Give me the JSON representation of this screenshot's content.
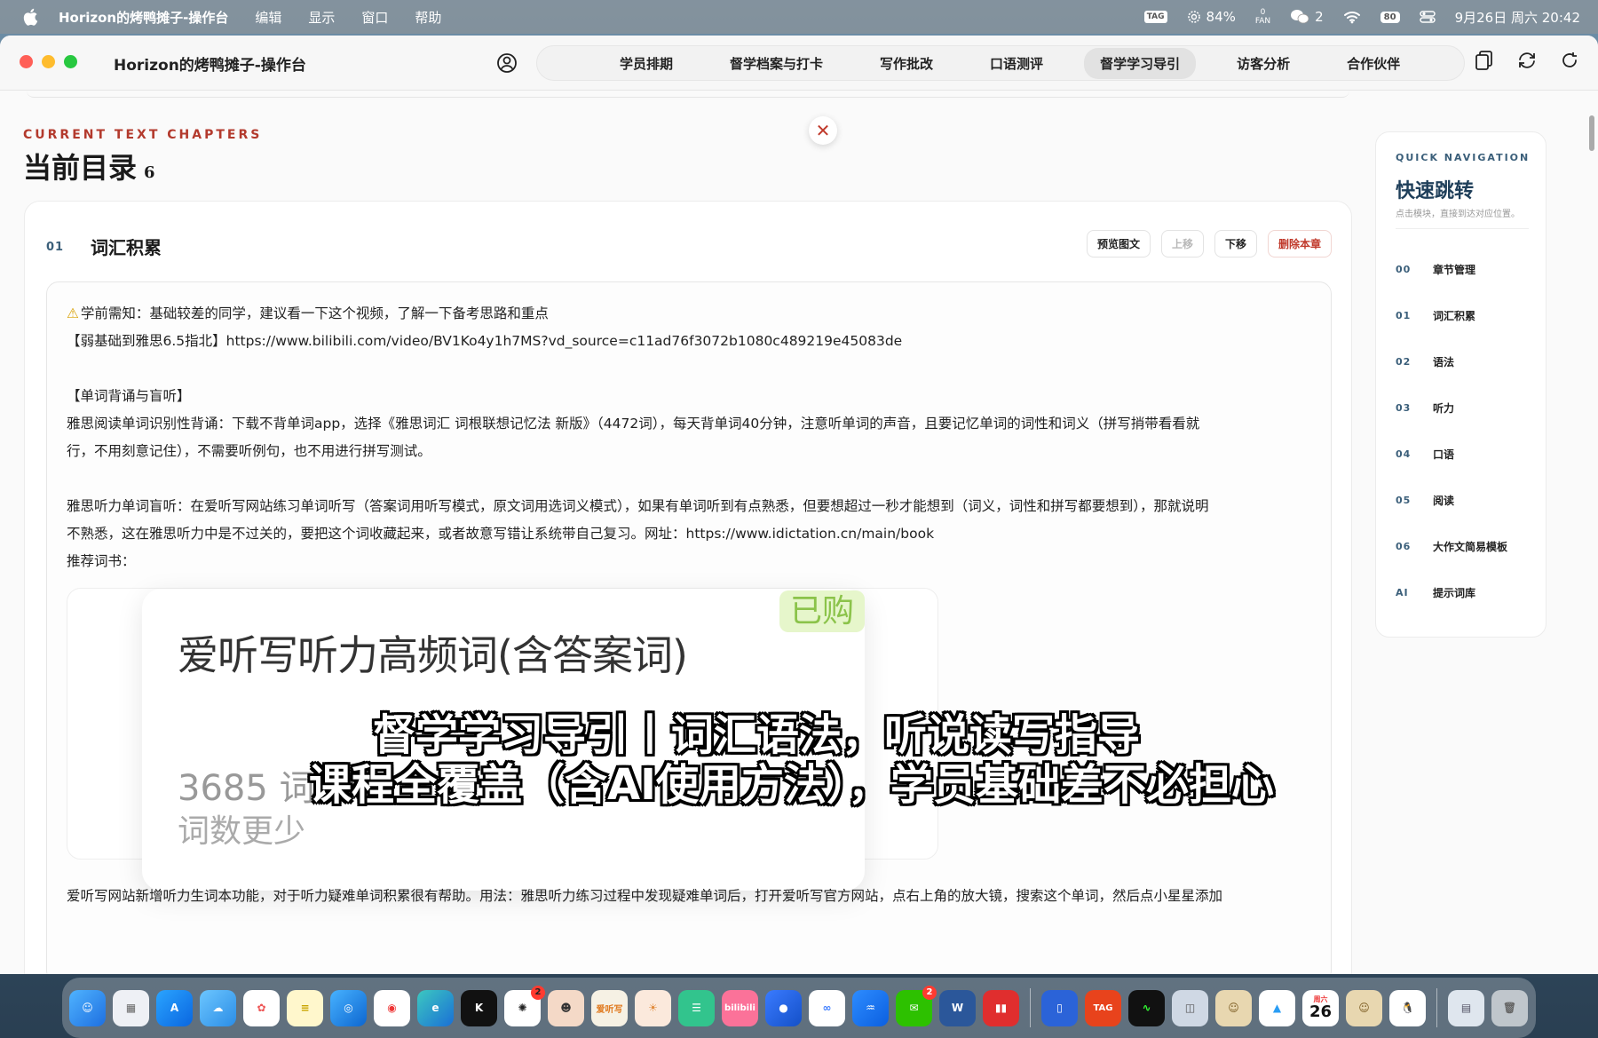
{
  "menubar": {
    "app_name": "Horizon的烤鸭摊子-操作台",
    "menus": [
      "编辑",
      "显示",
      "窗口",
      "帮助"
    ],
    "battery_percent": "84%",
    "fan_value": "0",
    "fan_label": "FAN",
    "wechat_count": "2",
    "battery_box": "80",
    "tag_label": "TAG",
    "datetime": "9月26日 周六 20:42"
  },
  "window": {
    "title": "Horizon的烤鸭摊子-操作台",
    "nav_tabs": [
      "学员排期",
      "督学档案与打卡",
      "写作批改",
      "口语测评",
      "督学学习导引",
      "访客分析",
      "合作伙伴"
    ],
    "active_tab_index": 4
  },
  "page": {
    "kicker": "CURRENT TEXT CHAPTERS",
    "heading": "当前目录",
    "chapter_count": "6"
  },
  "chapter": {
    "number": "01",
    "title": "词汇积累",
    "actions": {
      "preview": "预览图文",
      "move_up": "上移",
      "move_down": "下移",
      "delete": "删除本章"
    },
    "content": {
      "warn_line": "学前需知：基础较差的同学，建议看一下这个视频，了解一下备考思路和重点",
      "video_line": "【弱基础到雅思6.5指北】https://www.bilibili.com/video/BV1Ko4y1h7MS?vd_source=c11ad76f3072b1080c489219e45083de",
      "section_title": "【单词背诵与盲听】",
      "reading_line1": "雅思阅读单词识别性背诵：下载不背单词app，选择《雅思词汇 词根联想记忆法 新版》（4472词），每天背单词40分钟，注意听单词的声音，且要记忆单词的词性和词义（拼写捎带看看就",
      "reading_line2": "行，不用刻意记住），不需要听例句，也不用进行拼写测试。",
      "listening_line1": "雅思听力单词盲听：在爱听写网站练习单词听写（答案词用听写模式，原文词用选词义模式），如果有单词听到有点熟悉，但要想超过一秒才能想到（词义，词性和拼写都要想到），那就说明",
      "listening_line2": "不熟悉，这在雅思听力中是不过关的，要把这个词收藏起来，或者故意写错让系统带自己复习。网址：https://www.idictation.cn/main/book",
      "recommend_label": "推荐词书：",
      "bottom_line": "爱听写网站新增听力生词本功能，对于听力疑难单词积累很有帮助。用法：雅思听力练习过程中发现疑难单词后，打开爱听写官方网站，点右上角的放大镜，搜索这个单词，然后点小星星添加"
    },
    "image_card": {
      "bought_tag": "已购",
      "book_title": "爱听写听力高频词(含答案词)",
      "word_count": "3685 词",
      "word_sub": "词数更少"
    }
  },
  "subtitle": {
    "line1": "督学学习导引丨词汇语法，听说读写指导",
    "line2": "课程全覆盖（含AI使用方法），学员基础差不必担心"
  },
  "quick_nav": {
    "kicker": "QUICK NAVIGATION",
    "title": "快速跳转",
    "hint": "点击模块，直接到达对应位置。",
    "items": [
      {
        "num": "00",
        "label": "章节管理"
      },
      {
        "num": "01",
        "label": "词汇积累"
      },
      {
        "num": "02",
        "label": "语法"
      },
      {
        "num": "03",
        "label": "听力"
      },
      {
        "num": "04",
        "label": "口语"
      },
      {
        "num": "05",
        "label": "阅读"
      },
      {
        "num": "06",
        "label": "大作文简易模板"
      },
      {
        "num": "AI",
        "label": "提示词库"
      }
    ]
  },
  "dock": {
    "calendar_day": "26",
    "calendar_weekday": "周六",
    "wechat_badge": "2",
    "chatgpt_badge": "2",
    "tag_label": "TAG",
    "aitingxie_label": "爱听写",
    "bilibili_label": "bilibili"
  },
  "colors": {
    "accent_red": "#b33a2d",
    "accent_blue": "#3b5f7a",
    "active_tab_bg": "#e2e2e2"
  }
}
